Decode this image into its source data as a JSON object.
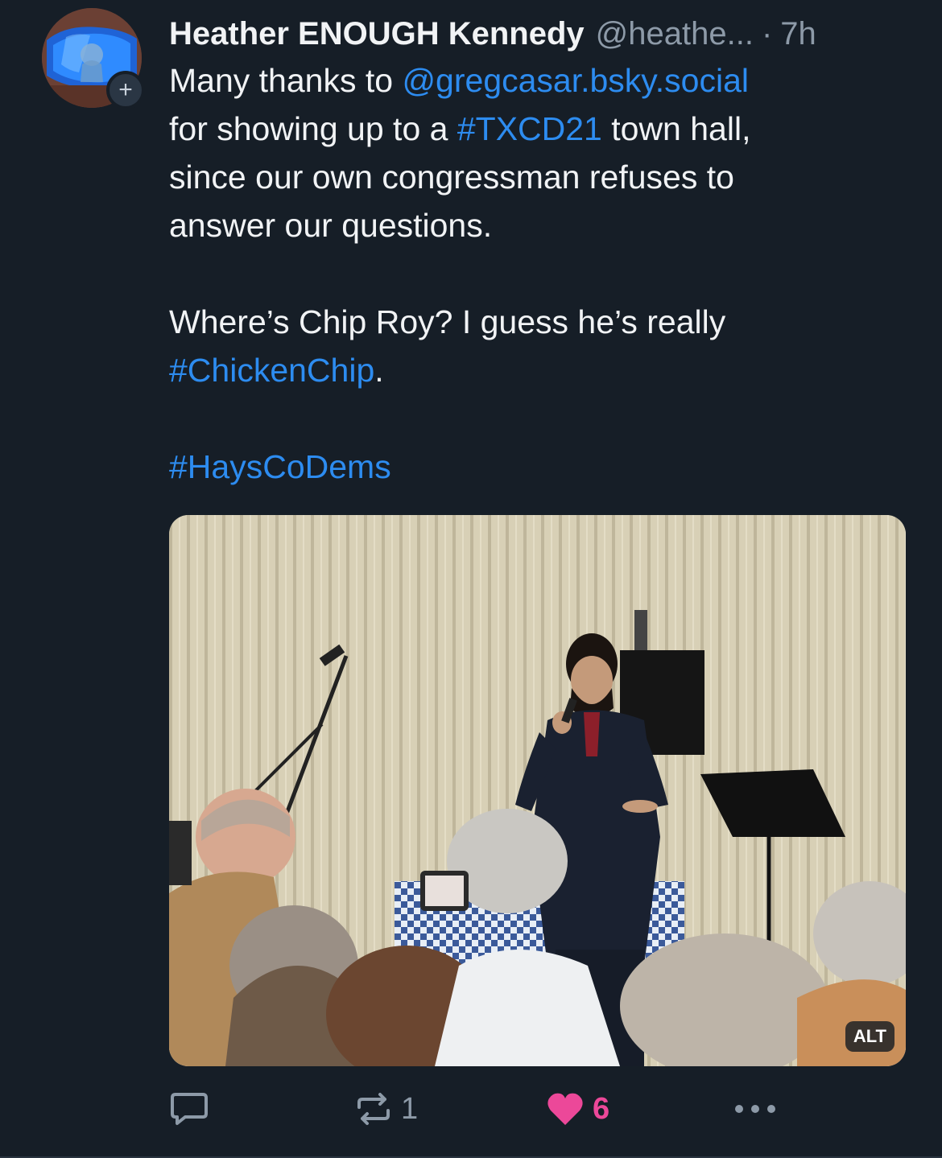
{
  "author": {
    "display_name": "Heather ENOUGH Kennedy",
    "handle": "@heathe...",
    "separator": "·",
    "time": "7h",
    "follow_symbol": "+"
  },
  "post": {
    "line1_prefix": "Many thanks to ",
    "mention": "@gregcasar.bsky.social",
    "line2_prefix": "for showing up to a ",
    "hashtag1": "#TXCD21",
    "line2_suffix": " town hall,",
    "line3": "since our own congressman refuses to",
    "line4": "answer our questions.",
    "line5": "Where’s Chip Roy? I guess he’s really",
    "hashtag2": "#ChickenChip",
    "hashtag2_suffix": ".",
    "hashtag3": "#HaysCoDems"
  },
  "media": {
    "alt_label": "ALT"
  },
  "actions": {
    "reply_icon": "reply-icon",
    "repost_icon": "repost-icon",
    "repost_count": "1",
    "like_icon": "heart-icon",
    "like_count": "6",
    "more_icon": "more-icon",
    "like_color": "#ec4899"
  },
  "theme": {
    "background": "#161e27",
    "link_color": "#2d8cf0",
    "muted_color": "#8d9aa8"
  }
}
